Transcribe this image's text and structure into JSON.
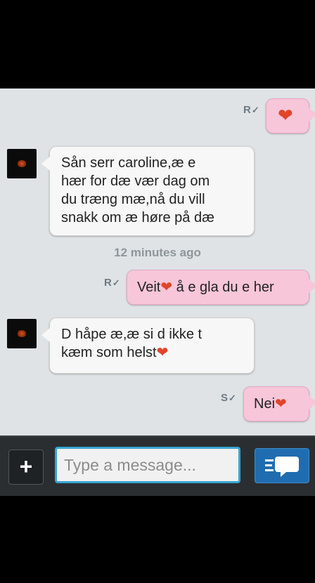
{
  "messages": [
    {
      "direction": "out",
      "status": "R",
      "text": "❤"
    },
    {
      "direction": "in",
      "lines": [
        "Sån serr caroline,æ e",
        "hær for dæ vær dag om",
        "du træng mæ,nå du vill",
        "snakk om æ høre på dæ"
      ]
    },
    {
      "timestamp": "12 minutes ago"
    },
    {
      "direction": "out",
      "status": "R",
      "text_a": "Veit",
      "heart": "❤",
      "text_b": " å e gla du e her"
    },
    {
      "direction": "in",
      "lines": [
        "D håpe æ,æ si d ikke t",
        "kæm som helst"
      ],
      "heart": "❤"
    },
    {
      "direction": "out",
      "status": "S",
      "text": "Nei",
      "heart": "❤"
    }
  ],
  "compose": {
    "placeholder": "Type a message..."
  },
  "icons": {
    "add": "plus-icon",
    "send": "chat-send-icon",
    "tick": "checkmark-icon"
  },
  "colors": {
    "chat_bg": "#dfe3e6",
    "incoming_bubble": "#f7f7f7",
    "outgoing_bubble": "#f7c6d8",
    "input_border": "#37a5d0",
    "send_button": "#1f6db0"
  }
}
